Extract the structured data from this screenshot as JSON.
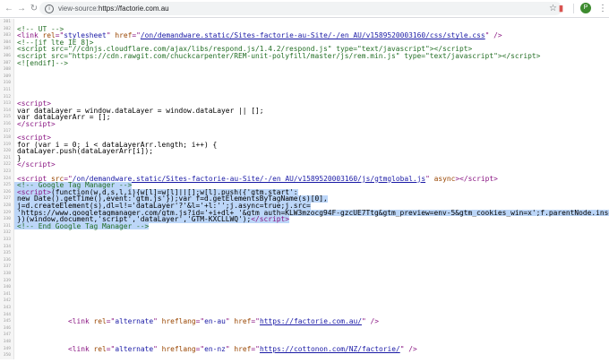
{
  "browser": {
    "url_scheme": "view-source:",
    "url_rest": "https://factorie.com.au",
    "avatar_letter": "P",
    "icons": {
      "back": "arrow-left",
      "forward": "arrow-right",
      "reload": "reload",
      "info": "info-circle",
      "star": "star",
      "extension": "extension",
      "menu": "vertical-dots"
    }
  },
  "colors": {
    "tag": "#881280",
    "attr": "#994500",
    "value": "#1a1aa6",
    "comment": "#236e25",
    "selection": "#bcd6f8"
  },
  "lines": [
    {
      "n": "301",
      "segs": []
    },
    {
      "n": "302",
      "segs": [
        {
          "c": "cmt",
          "t": "<!-- UT -->"
        }
      ]
    },
    {
      "n": "303",
      "segs": [
        {
          "c": "tag",
          "t": "<link "
        },
        {
          "c": "attr",
          "t": "rel"
        },
        {
          "c": "tag",
          "t": "=\""
        },
        {
          "c": "val",
          "t": "stylesheet"
        },
        {
          "c": "tag",
          "t": "\" "
        },
        {
          "c": "attr",
          "t": "href"
        },
        {
          "c": "tag",
          "t": "=\""
        },
        {
          "c": "link",
          "t": "/on/demandware.static/Sites-factorie-au-Site/-/en_AU/v1589520003160/css/style.css"
        },
        {
          "c": "tag",
          "t": "\" />"
        }
      ]
    },
    {
      "n": "304",
      "segs": [
        {
          "c": "cmt",
          "t": "<!--[if lte IE 8]>"
        }
      ]
    },
    {
      "n": "305",
      "segs": [
        {
          "c": "cmt",
          "t": "<script src=\"//cdnjs.cloudflare.com/ajax/libs/respond.js/1.4.2/respond.js\" type=\"text/javascript\"></script>"
        }
      ]
    },
    {
      "n": "306",
      "segs": [
        {
          "c": "cmt",
          "t": "<script src=\"https://cdn.rawgit.com/chuckcarpenter/REM-unit-polyfill/master/js/rem.min.js\" type=\"text/javascript\"></script>"
        }
      ]
    },
    {
      "n": "307",
      "segs": [
        {
          "c": "cmt",
          "t": "<![endif]-->"
        }
      ]
    },
    {
      "n": "308",
      "segs": []
    },
    {
      "n": "309",
      "segs": []
    },
    {
      "n": "310",
      "segs": []
    },
    {
      "n": "311",
      "segs": []
    },
    {
      "n": "312",
      "segs": []
    },
    {
      "n": "313",
      "segs": [
        {
          "c": "tag",
          "t": "<script>"
        }
      ]
    },
    {
      "n": "314",
      "segs": [
        {
          "c": "txt",
          "t": "var dataLayer = window.dataLayer = window.dataLayer || [];"
        }
      ]
    },
    {
      "n": "315",
      "segs": [
        {
          "c": "txt",
          "t": "var dataLayerArr = [];"
        }
      ]
    },
    {
      "n": "316",
      "segs": [
        {
          "c": "tag",
          "t": "</script>"
        }
      ]
    },
    {
      "n": "317",
      "segs": []
    },
    {
      "n": "318",
      "segs": [
        {
          "c": "tag",
          "t": "<script>"
        }
      ]
    },
    {
      "n": "319",
      "segs": [
        {
          "c": "txt",
          "t": "for (var i = 0; i < dataLayerArr.length; i++) {"
        }
      ]
    },
    {
      "n": "320",
      "segs": [
        {
          "c": "txt",
          "t": "dataLayer.push(dataLayerArr[i]);"
        }
      ]
    },
    {
      "n": "321",
      "segs": [
        {
          "c": "txt",
          "t": "}"
        }
      ]
    },
    {
      "n": "322",
      "segs": [
        {
          "c": "tag",
          "t": "</script>"
        }
      ]
    },
    {
      "n": "323",
      "segs": []
    },
    {
      "n": "324",
      "segs": [
        {
          "c": "tag",
          "t": "<script "
        },
        {
          "c": "attr",
          "t": "src"
        },
        {
          "c": "tag",
          "t": "=\""
        },
        {
          "c": "link",
          "t": "/on/demandware.static/Sites-factorie-au-Site/-/en_AU/v1589520003160/js/gtmglobal.js"
        },
        {
          "c": "tag",
          "t": "\" "
        },
        {
          "c": "attr",
          "t": "async"
        },
        {
          "c": "tag",
          "t": "></script>"
        }
      ]
    },
    {
      "n": "325",
      "sel": true,
      "segs": [
        {
          "c": "cmt",
          "t": "<!-- Google Tag Manager -->"
        }
      ]
    },
    {
      "n": "326",
      "sel": true,
      "segs": [
        {
          "c": "tag",
          "t": "<script>"
        },
        {
          "c": "txt",
          "t": "(function(w,d,s,l,i){w[l]=w[l]||[];w[l].push({'gtm.start':"
        }
      ]
    },
    {
      "n": "327",
      "sel": true,
      "segs": [
        {
          "c": "txt",
          "t": "new Date().getTime(),event:'gtm.js'});var f=d.getElementsByTagName(s)[0],"
        }
      ]
    },
    {
      "n": "328",
      "sel": true,
      "segs": [
        {
          "c": "txt",
          "t": "j=d.createElement(s),dl=l!='dataLayer'?'&l='+l:'';j.async=true;j.src="
        }
      ]
    },
    {
      "n": "329",
      "sel": true,
      "segs": [
        {
          "c": "txt",
          "t": "'https://www.googletagmanager.com/gtm.js?id='+i+dl+ '&gtm_auth=KLW3mzocg94F-gzcUE7Ttg&gtm_preview=env-5&gtm_cookies_win=x';f.parentNode.insertBefore(j,f);"
        }
      ]
    },
    {
      "n": "330",
      "sel": true,
      "segs": [
        {
          "c": "txt",
          "t": "})(window,document,'script','dataLayer','GTM-KXCLLWQ');"
        },
        {
          "c": "tag",
          "t": "</script>"
        }
      ]
    },
    {
      "n": "331",
      "sel": true,
      "segs": [
        {
          "c": "cmt",
          "t": "<!-- End Google Tag Manager -->"
        }
      ]
    },
    {
      "n": "332",
      "segs": []
    },
    {
      "n": "333",
      "segs": []
    },
    {
      "n": "334",
      "segs": []
    },
    {
      "n": "335",
      "segs": []
    },
    {
      "n": "336",
      "segs": []
    },
    {
      "n": "337",
      "segs": []
    },
    {
      "n": "338",
      "segs": []
    },
    {
      "n": "339",
      "segs": []
    },
    {
      "n": "340",
      "segs": []
    },
    {
      "n": "341",
      "segs": []
    },
    {
      "n": "342",
      "segs": []
    },
    {
      "n": "343",
      "segs": []
    },
    {
      "n": "344",
      "segs": []
    },
    {
      "n": "345",
      "segs": [
        {
          "c": "txt",
          "t": "            "
        },
        {
          "c": "tag",
          "t": "<link "
        },
        {
          "c": "attr",
          "t": "rel"
        },
        {
          "c": "tag",
          "t": "=\""
        },
        {
          "c": "val",
          "t": "alternate"
        },
        {
          "c": "tag",
          "t": "\" "
        },
        {
          "c": "attr",
          "t": "hreflang"
        },
        {
          "c": "tag",
          "t": "=\""
        },
        {
          "c": "val",
          "t": "en-au"
        },
        {
          "c": "tag",
          "t": "\" "
        },
        {
          "c": "attr",
          "t": "href"
        },
        {
          "c": "tag",
          "t": "=\""
        },
        {
          "c": "link",
          "t": "https://factorie.com.au/"
        },
        {
          "c": "tag",
          "t": "\" />"
        }
      ]
    },
    {
      "n": "346",
      "segs": []
    },
    {
      "n": "347",
      "segs": []
    },
    {
      "n": "348",
      "segs": []
    },
    {
      "n": "349",
      "segs": [
        {
          "c": "txt",
          "t": "            "
        },
        {
          "c": "tag",
          "t": "<link "
        },
        {
          "c": "attr",
          "t": "rel"
        },
        {
          "c": "tag",
          "t": "=\""
        },
        {
          "c": "val",
          "t": "alternate"
        },
        {
          "c": "tag",
          "t": "\" "
        },
        {
          "c": "attr",
          "t": "hreflang"
        },
        {
          "c": "tag",
          "t": "=\""
        },
        {
          "c": "val",
          "t": "en-nz"
        },
        {
          "c": "tag",
          "t": "\" "
        },
        {
          "c": "attr",
          "t": "href"
        },
        {
          "c": "tag",
          "t": "=\""
        },
        {
          "c": "link",
          "t": "https://cottonon.com/NZ/factorie/"
        },
        {
          "c": "tag",
          "t": "\" />"
        }
      ]
    },
    {
      "n": "350",
      "segs": []
    }
  ]
}
